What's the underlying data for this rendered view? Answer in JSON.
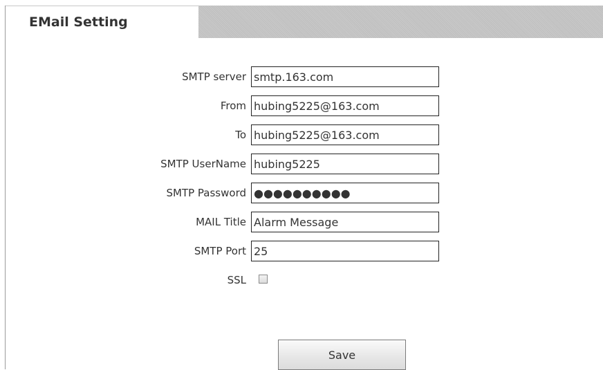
{
  "tab": {
    "title": "EMail Setting"
  },
  "form": {
    "smtp_server": {
      "label": "SMTP server",
      "value": "smtp.163.com"
    },
    "from": {
      "label": "From",
      "value": "hubing5225@163.com"
    },
    "to": {
      "label": "To",
      "value": "hubing5225@163.com"
    },
    "smtp_username": {
      "label": "SMTP UserName",
      "value": "hubing5225"
    },
    "smtp_password": {
      "label": "SMTP Password",
      "value": "●●●●●●●●●●"
    },
    "mail_title": {
      "label": "MAIL Title",
      "value": "Alarm Message"
    },
    "smtp_port": {
      "label": "SMTP Port",
      "value": "25"
    },
    "ssl": {
      "label": "SSL",
      "checked": false
    }
  },
  "actions": {
    "save_label": "Save"
  }
}
